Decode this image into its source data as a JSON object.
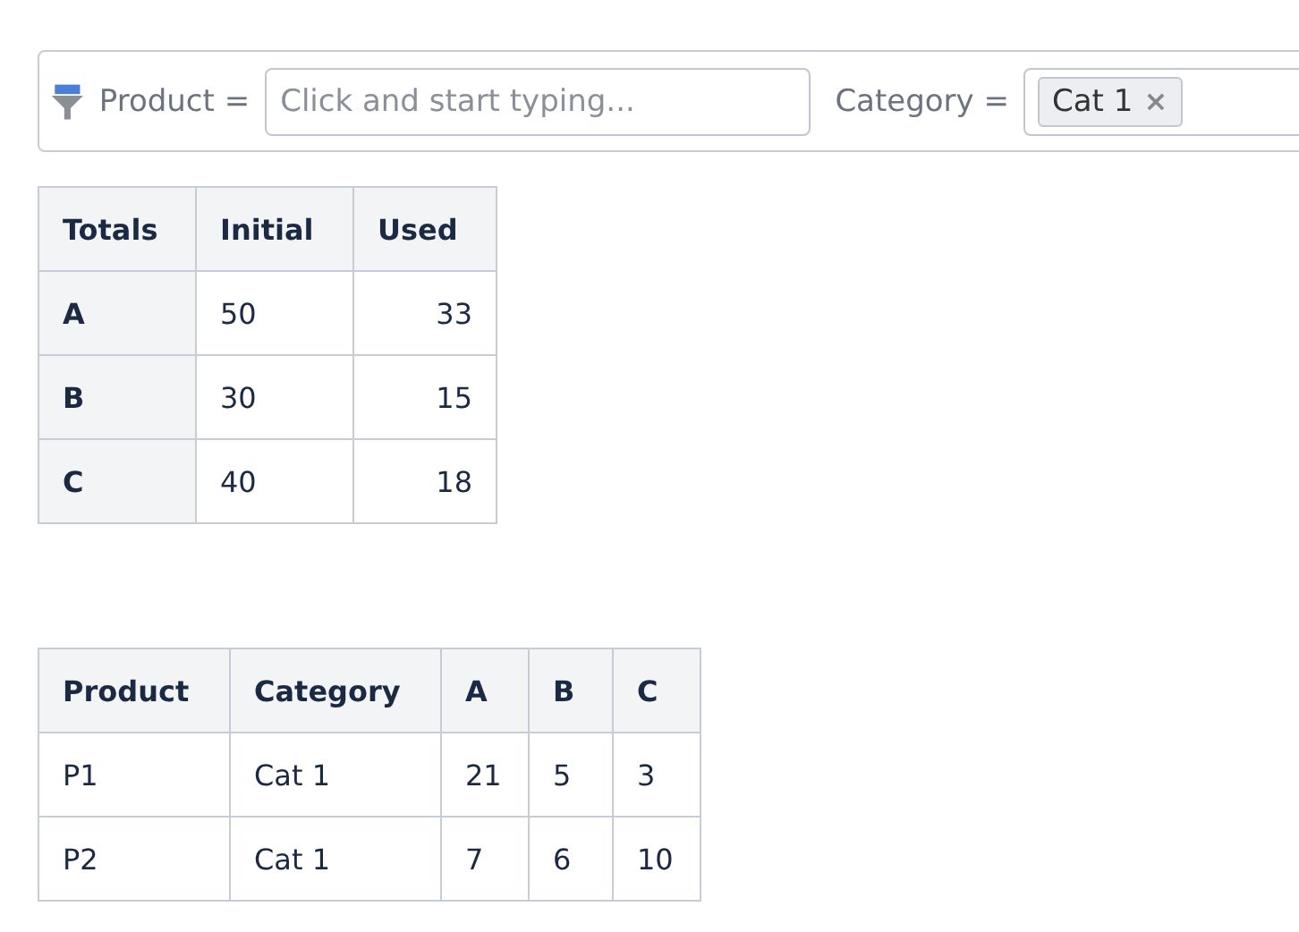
{
  "filter_bar": {
    "filters": [
      {
        "kind": "text",
        "label": "Product =",
        "placeholder": "Click and start typing..."
      },
      {
        "kind": "chips",
        "label": "Category =",
        "chips": [
          {
            "label": "Cat 1",
            "remove": "×"
          }
        ]
      }
    ]
  },
  "totals_table": {
    "columns": [
      "Totals",
      "Initial",
      "Used"
    ],
    "rows": [
      [
        "A",
        "50",
        "33"
      ],
      [
        "B",
        "30",
        "15"
      ],
      [
        "C",
        "40",
        "18"
      ]
    ]
  },
  "products_table": {
    "columns": [
      "Product",
      "Category",
      "A",
      "B",
      "C"
    ],
    "rows": [
      [
        "P1",
        "Cat 1",
        "21",
        "5",
        "3"
      ],
      [
        "P2",
        "Cat 1",
        "7",
        "6",
        "10"
      ]
    ]
  }
}
